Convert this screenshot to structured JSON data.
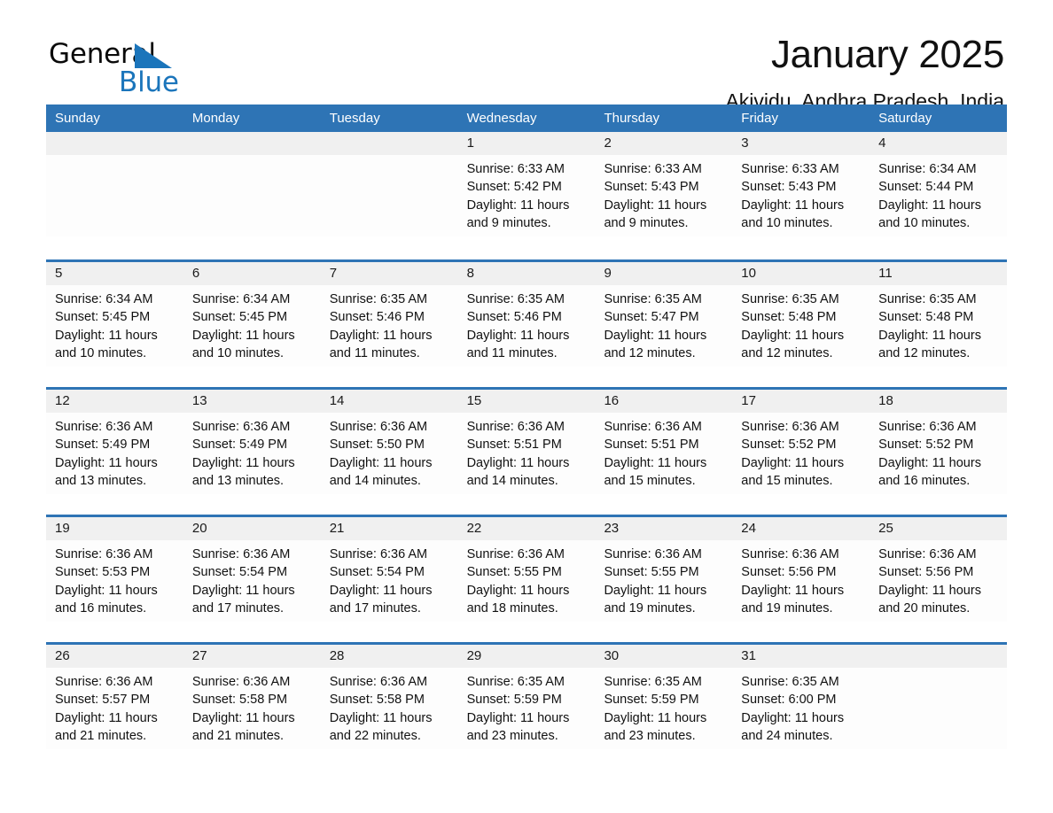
{
  "logo": {
    "line1": "General",
    "line2": "Blue",
    "triangle_color": "#1b75bb"
  },
  "header": {
    "month_title": "January 2025",
    "location": "Akividu, Andhra Pradesh, India"
  },
  "theme": {
    "header_blue": "#2e74b5",
    "row_rule_blue": "#2e74b5",
    "number_strip_gray": "#f0f0f0",
    "text_color": "#111111"
  },
  "calendar": {
    "weekday_headers": [
      "Sunday",
      "Monday",
      "Tuesday",
      "Wednesday",
      "Thursday",
      "Friday",
      "Saturday"
    ],
    "weeks": [
      [
        {
          "day": "",
          "lines": []
        },
        {
          "day": "",
          "lines": []
        },
        {
          "day": "",
          "lines": []
        },
        {
          "day": "1",
          "lines": [
            "Sunrise: 6:33 AM",
            "Sunset: 5:42 PM",
            "Daylight: 11 hours",
            "and 9 minutes."
          ]
        },
        {
          "day": "2",
          "lines": [
            "Sunrise: 6:33 AM",
            "Sunset: 5:43 PM",
            "Daylight: 11 hours",
            "and 9 minutes."
          ]
        },
        {
          "day": "3",
          "lines": [
            "Sunrise: 6:33 AM",
            "Sunset: 5:43 PM",
            "Daylight: 11 hours",
            "and 10 minutes."
          ]
        },
        {
          "day": "4",
          "lines": [
            "Sunrise: 6:34 AM",
            "Sunset: 5:44 PM",
            "Daylight: 11 hours",
            "and 10 minutes."
          ]
        }
      ],
      [
        {
          "day": "5",
          "lines": [
            "Sunrise: 6:34 AM",
            "Sunset: 5:45 PM",
            "Daylight: 11 hours",
            "and 10 minutes."
          ]
        },
        {
          "day": "6",
          "lines": [
            "Sunrise: 6:34 AM",
            "Sunset: 5:45 PM",
            "Daylight: 11 hours",
            "and 10 minutes."
          ]
        },
        {
          "day": "7",
          "lines": [
            "Sunrise: 6:35 AM",
            "Sunset: 5:46 PM",
            "Daylight: 11 hours",
            "and 11 minutes."
          ]
        },
        {
          "day": "8",
          "lines": [
            "Sunrise: 6:35 AM",
            "Sunset: 5:46 PM",
            "Daylight: 11 hours",
            "and 11 minutes."
          ]
        },
        {
          "day": "9",
          "lines": [
            "Sunrise: 6:35 AM",
            "Sunset: 5:47 PM",
            "Daylight: 11 hours",
            "and 12 minutes."
          ]
        },
        {
          "day": "10",
          "lines": [
            "Sunrise: 6:35 AM",
            "Sunset: 5:48 PM",
            "Daylight: 11 hours",
            "and 12 minutes."
          ]
        },
        {
          "day": "11",
          "lines": [
            "Sunrise: 6:35 AM",
            "Sunset: 5:48 PM",
            "Daylight: 11 hours",
            "and 12 minutes."
          ]
        }
      ],
      [
        {
          "day": "12",
          "lines": [
            "Sunrise: 6:36 AM",
            "Sunset: 5:49 PM",
            "Daylight: 11 hours",
            "and 13 minutes."
          ]
        },
        {
          "day": "13",
          "lines": [
            "Sunrise: 6:36 AM",
            "Sunset: 5:49 PM",
            "Daylight: 11 hours",
            "and 13 minutes."
          ]
        },
        {
          "day": "14",
          "lines": [
            "Sunrise: 6:36 AM",
            "Sunset: 5:50 PM",
            "Daylight: 11 hours",
            "and 14 minutes."
          ]
        },
        {
          "day": "15",
          "lines": [
            "Sunrise: 6:36 AM",
            "Sunset: 5:51 PM",
            "Daylight: 11 hours",
            "and 14 minutes."
          ]
        },
        {
          "day": "16",
          "lines": [
            "Sunrise: 6:36 AM",
            "Sunset: 5:51 PM",
            "Daylight: 11 hours",
            "and 15 minutes."
          ]
        },
        {
          "day": "17",
          "lines": [
            "Sunrise: 6:36 AM",
            "Sunset: 5:52 PM",
            "Daylight: 11 hours",
            "and 15 minutes."
          ]
        },
        {
          "day": "18",
          "lines": [
            "Sunrise: 6:36 AM",
            "Sunset: 5:52 PM",
            "Daylight: 11 hours",
            "and 16 minutes."
          ]
        }
      ],
      [
        {
          "day": "19",
          "lines": [
            "Sunrise: 6:36 AM",
            "Sunset: 5:53 PM",
            "Daylight: 11 hours",
            "and 16 minutes."
          ]
        },
        {
          "day": "20",
          "lines": [
            "Sunrise: 6:36 AM",
            "Sunset: 5:54 PM",
            "Daylight: 11 hours",
            "and 17 minutes."
          ]
        },
        {
          "day": "21",
          "lines": [
            "Sunrise: 6:36 AM",
            "Sunset: 5:54 PM",
            "Daylight: 11 hours",
            "and 17 minutes."
          ]
        },
        {
          "day": "22",
          "lines": [
            "Sunrise: 6:36 AM",
            "Sunset: 5:55 PM",
            "Daylight: 11 hours",
            "and 18 minutes."
          ]
        },
        {
          "day": "23",
          "lines": [
            "Sunrise: 6:36 AM",
            "Sunset: 5:55 PM",
            "Daylight: 11 hours",
            "and 19 minutes."
          ]
        },
        {
          "day": "24",
          "lines": [
            "Sunrise: 6:36 AM",
            "Sunset: 5:56 PM",
            "Daylight: 11 hours",
            "and 19 minutes."
          ]
        },
        {
          "day": "25",
          "lines": [
            "Sunrise: 6:36 AM",
            "Sunset: 5:56 PM",
            "Daylight: 11 hours",
            "and 20 minutes."
          ]
        }
      ],
      [
        {
          "day": "26",
          "lines": [
            "Sunrise: 6:36 AM",
            "Sunset: 5:57 PM",
            "Daylight: 11 hours",
            "and 21 minutes."
          ]
        },
        {
          "day": "27",
          "lines": [
            "Sunrise: 6:36 AM",
            "Sunset: 5:58 PM",
            "Daylight: 11 hours",
            "and 21 minutes."
          ]
        },
        {
          "day": "28",
          "lines": [
            "Sunrise: 6:36 AM",
            "Sunset: 5:58 PM",
            "Daylight: 11 hours",
            "and 22 minutes."
          ]
        },
        {
          "day": "29",
          "lines": [
            "Sunrise: 6:35 AM",
            "Sunset: 5:59 PM",
            "Daylight: 11 hours",
            "and 23 minutes."
          ]
        },
        {
          "day": "30",
          "lines": [
            "Sunrise: 6:35 AM",
            "Sunset: 5:59 PM",
            "Daylight: 11 hours",
            "and 23 minutes."
          ]
        },
        {
          "day": "31",
          "lines": [
            "Sunrise: 6:35 AM",
            "Sunset: 6:00 PM",
            "Daylight: 11 hours",
            "and 24 minutes."
          ]
        },
        {
          "day": "",
          "lines": []
        }
      ]
    ]
  }
}
